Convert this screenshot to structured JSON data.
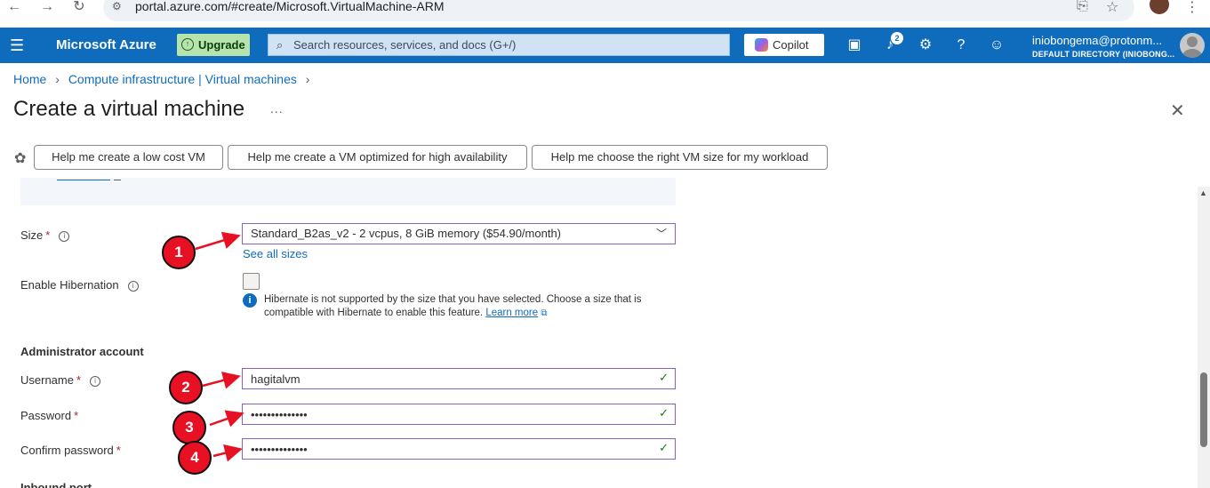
{
  "browser": {
    "url": "portal.azure.com/#create/Microsoft.VirtualMachine-ARM"
  },
  "header": {
    "brand": "Microsoft Azure",
    "upgrade_label": "Upgrade",
    "search_placeholder": "Search resources, services, and docs (G+/)",
    "copilot_label": "Copilot",
    "notification_count": "2",
    "account_email": "iniobongema@protonm...",
    "account_directory": "DEFAULT DIRECTORY (INIOBONG..."
  },
  "breadcrumb": {
    "home": "Home",
    "parent": "Compute infrastructure | Virtual machines"
  },
  "page": {
    "title": "Create a virtual machine",
    "more": "..."
  },
  "suggestions": [
    "Help me create a low cost VM",
    "Help me create a VM optimized for high availability",
    "Help me choose the right VM size for my workload"
  ],
  "form": {
    "size_label": "Size",
    "size_value": "Standard_B2as_v2 - 2 vcpus, 8 GiB memory ($54.90/month)",
    "see_all_sizes": "See all sizes",
    "hibernation_label": "Enable Hibernation",
    "hibernation_hint": "Hibernate is not supported by the size that you have selected. Choose a size that is compatible with Hibernate to enable this feature.",
    "learn_more": "Learn more",
    "admin_section": "Administrator account",
    "username_label": "Username",
    "username_value": "hagitalvm",
    "password_label": "Password",
    "password_value": "••••••••••••••",
    "confirm_label": "Confirm password",
    "confirm_value": "••••••••••••••",
    "required_mark": "*",
    "next_section_cut": "Inbound port rules"
  },
  "annotations": [
    "1",
    "2",
    "3",
    "4"
  ],
  "colors": {
    "azure_blue": "#0f6cbd",
    "marker_red": "#e81123",
    "valid_green": "#107c10",
    "focus_purple": "#8764b8"
  }
}
